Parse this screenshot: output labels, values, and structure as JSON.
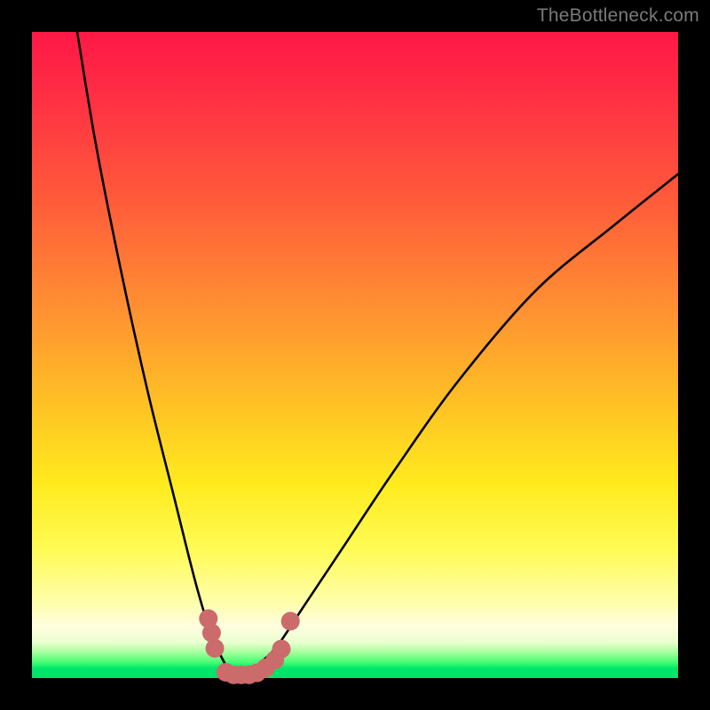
{
  "watermark": {
    "text": "TheBottleneck.com"
  },
  "colors": {
    "frame": "#000000",
    "watermark": "#7a7a7a",
    "curve": "#000000",
    "markers": "#cc6b6b",
    "gradient_stops": [
      "#ff1846",
      "#ff5b3a",
      "#ff9431",
      "#ffc324",
      "#ffeb1e",
      "#fffde0",
      "#49ff75",
      "#00e268"
    ]
  },
  "chart_data": {
    "type": "line",
    "title": "",
    "xlabel": "",
    "ylabel": "",
    "xlim": [
      0,
      100
    ],
    "ylim": [
      0,
      100
    ],
    "series": [
      {
        "name": "bottleneck-curve",
        "note": "V-shaped curve; vertex near x≈32, y≈0; left branch steep toward y=100 at x≈7; right branch rises to y≈78 at x=100. Values approximate, read from plot.",
        "x": [
          7,
          10,
          14,
          18,
          22,
          25,
          27,
          28.5,
          30,
          31,
          32,
          33,
          34,
          35.5,
          38,
          42,
          48,
          56,
          66,
          78,
          90,
          100
        ],
        "y": [
          100,
          82,
          62,
          44,
          28,
          16,
          9,
          5,
          2,
          0.6,
          0,
          0.4,
          1.2,
          2.5,
          5,
          11,
          20,
          32,
          46,
          60,
          70,
          78
        ]
      }
    ],
    "markers": {
      "name": "highlight-dots",
      "note": "Salmon dots clustered around the trough of the curve.",
      "points": [
        {
          "x": 27.3,
          "y": 9.2
        },
        {
          "x": 27.8,
          "y": 7.0
        },
        {
          "x": 28.3,
          "y": 4.6
        },
        {
          "x": 30.0,
          "y": 0.9
        },
        {
          "x": 31.2,
          "y": 0.5
        },
        {
          "x": 32.4,
          "y": 0.5
        },
        {
          "x": 33.6,
          "y": 0.5
        },
        {
          "x": 34.8,
          "y": 0.8
        },
        {
          "x": 36.2,
          "y": 1.6
        },
        {
          "x": 37.6,
          "y": 2.8
        },
        {
          "x": 38.6,
          "y": 4.5
        },
        {
          "x": 40.0,
          "y": 8.8
        }
      ]
    }
  }
}
